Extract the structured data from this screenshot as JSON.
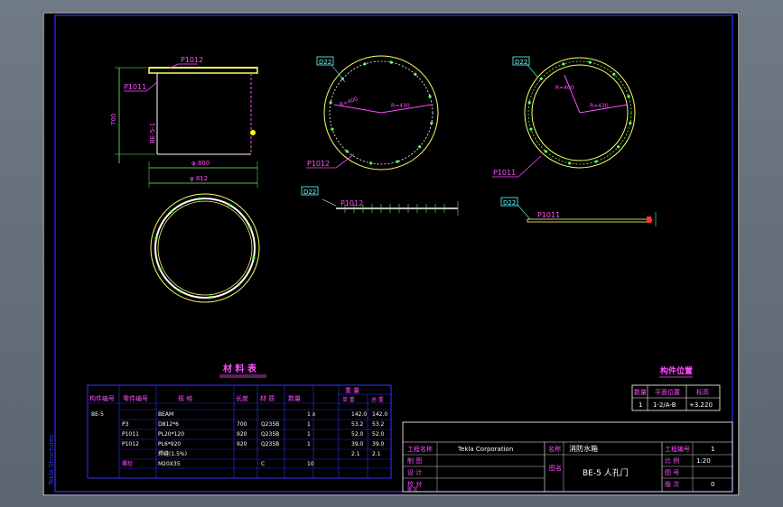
{
  "colors": {
    "background": "#000000",
    "frame": "#3333ff",
    "outline": "#ffff66",
    "annotation": "#ff4dff",
    "dimension": "#66ff66",
    "text": "#ffffff",
    "tag": "#66ffff"
  },
  "front_view": {
    "part_top": "P1012",
    "part_side": "P1011",
    "height_dim": "700",
    "side_mark": "BE-5-1",
    "inner_dia": "φ 800",
    "outer_dia": "φ 812"
  },
  "plate_top": {
    "tag": "D22",
    "radius_inner": "R=400",
    "radius_outer": "R=430",
    "part": "P1012",
    "elev_tag": "D22",
    "elev_part": "P1012"
  },
  "plate_side": {
    "tag": "D22",
    "radius_inner": "R=400",
    "radius_outer": "R=430",
    "part": "P1011",
    "elev_tag": "D22",
    "elev_part": "P1011"
  },
  "bom": {
    "title": "材 料 表",
    "headers": [
      "构件编号",
      "零件编号",
      "规   格",
      "长度",
      "材 质",
      "数量",
      "重 量"
    ],
    "weight_sub": [
      "单 重",
      "总 重"
    ],
    "rows": [
      [
        "BE-5",
        "",
        "BEAM",
        "",
        "",
        "1 x",
        "142.0",
        "142.0"
      ],
      [
        "",
        "P3",
        "D812*6",
        "700",
        "Q235B",
        "1",
        "53.2",
        "53.2"
      ],
      [
        "",
        "P1011",
        "PL20*120",
        "920",
        "Q235B",
        "1",
        "52.0",
        "52.0"
      ],
      [
        "",
        "P1012",
        "PL6*920",
        "920",
        "Q235B",
        "1",
        "39.0",
        "39.0"
      ],
      [
        "",
        "",
        "焊缝(1.5%)",
        "",
        "",
        "",
        "2.1",
        "2.1"
      ],
      [
        "",
        "螺栓",
        "M20X35",
        "",
        "C",
        "10",
        "",
        ""
      ]
    ]
  },
  "location_table": {
    "title": "构件位置",
    "headers": [
      "数量",
      "平面位置",
      "标高"
    ],
    "row": [
      "1",
      "1-2/A-B",
      "+3.220"
    ]
  },
  "title_block": {
    "project_label": "工程名称",
    "company": "Tekla Corporation",
    "name_label": "名称",
    "name_value": "消防水箱",
    "rows": [
      "制 图",
      "设 计",
      "校 对",
      "审 定"
    ],
    "drawing_label": "图名",
    "drawing_value": "BE-5 人孔门",
    "right_labels": [
      "工程编号",
      "比 例",
      "图 号",
      "版 次"
    ],
    "right_values": [
      "1",
      "1:20",
      "",
      "0"
    ]
  },
  "margin_text": "Tekla Structures"
}
